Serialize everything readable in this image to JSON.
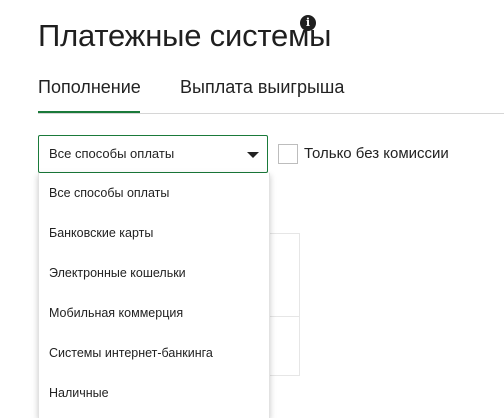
{
  "header": {
    "title": "Платежные системы",
    "info_icon_glyph": "i"
  },
  "tabs": [
    {
      "label": "Пополнение",
      "active": true
    },
    {
      "label": "Выплата выигрыша",
      "active": false
    }
  ],
  "colors": {
    "accent": "#1a7a3a",
    "text": "#222222"
  },
  "filter": {
    "selected": "Все способы оплаты",
    "options": [
      "Все способы оплаты",
      "Банковские карты",
      "Электронные кошельки",
      "Мобильная коммерция",
      "Системы интернет-банкинга",
      "Наличные"
    ],
    "no_fee_label": "Только без комиссии",
    "no_fee_checked": false
  }
}
